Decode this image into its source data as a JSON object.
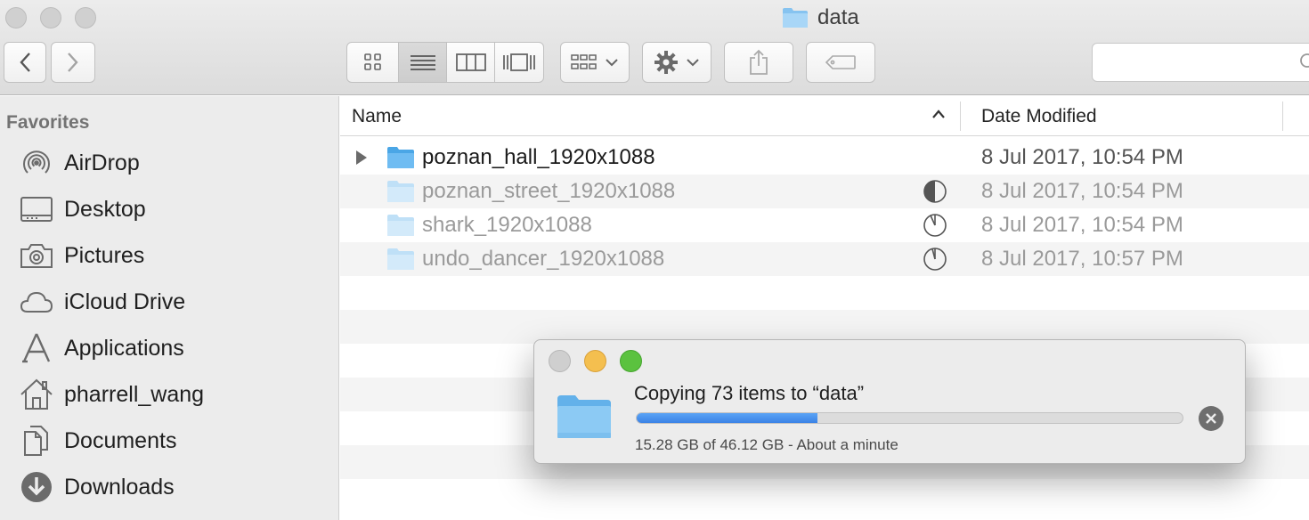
{
  "window": {
    "title": "data",
    "search_placeholder": ""
  },
  "toolbar": {
    "back": "chevron-left-icon",
    "forward": "chevron-right-icon",
    "views": [
      "icon-view",
      "list-view",
      "column-view",
      "cover-flow-view"
    ],
    "active_view": "list-view"
  },
  "sidebar": {
    "heading": "Favorites",
    "items": [
      {
        "label": "AirDrop",
        "icon": "airdrop-icon"
      },
      {
        "label": "Desktop",
        "icon": "desktop-icon"
      },
      {
        "label": "Pictures",
        "icon": "camera-icon"
      },
      {
        "label": "iCloud Drive",
        "icon": "cloud-icon"
      },
      {
        "label": "Applications",
        "icon": "applications-icon"
      },
      {
        "label": "pharrell_wang",
        "icon": "home-icon"
      },
      {
        "label": "Documents",
        "icon": "documents-icon"
      },
      {
        "label": "Downloads",
        "icon": "downloads-icon"
      }
    ]
  },
  "list": {
    "columns": {
      "name": "Name",
      "date": "Date Modified"
    },
    "rows": [
      {
        "name": "poznan_hall_1920x1088",
        "date": "8 Jul 2017, 10:54 PM",
        "copying": false
      },
      {
        "name": "poznan_street_1920x1088",
        "date": "8 Jul 2017, 10:54 PM",
        "copying": true,
        "progress": 0.5
      },
      {
        "name": "shark_1920x1088",
        "date": "8 Jul 2017, 10:54 PM",
        "copying": true,
        "progress": 0.05
      },
      {
        "name": "undo_dancer_1920x1088",
        "date": "8 Jul 2017, 10:57 PM",
        "copying": true,
        "progress": 0.02
      }
    ]
  },
  "copy_dialog": {
    "title": "Copying 73 items to “data”",
    "status": "15.28 GB of 46.12 GB - About a minute",
    "progress": 0.331,
    "colors": {
      "close": "#cfcfcf",
      "minimize": "#f4bf4f",
      "zoom": "#5bc23f",
      "bar": "#3b82e6"
    }
  }
}
